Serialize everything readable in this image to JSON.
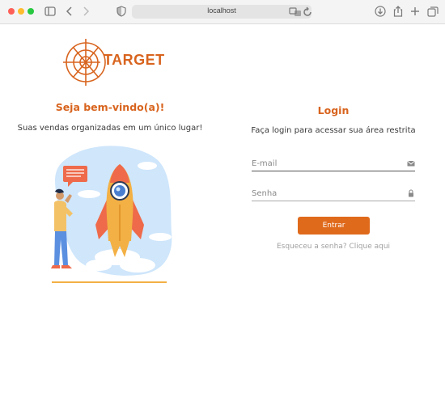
{
  "browser": {
    "url": "localhost",
    "traffic_lights": [
      "close",
      "minimize",
      "zoom"
    ]
  },
  "brand": {
    "logo_text": "TARGET",
    "color": "#d8641e"
  },
  "welcome": {
    "title": "Seja bem-vindo(a)!",
    "subtitle": "Suas vendas organizadas em um único lugar!"
  },
  "login": {
    "title": "Login",
    "subtitle": "Faça login para acessar sua área restrita",
    "email_placeholder": "E-mail",
    "password_placeholder": "Senha",
    "submit_label": "Entrar",
    "forgot_link": "Esqueceu a senha? Clique aqui",
    "accent": "#e06a1c"
  }
}
